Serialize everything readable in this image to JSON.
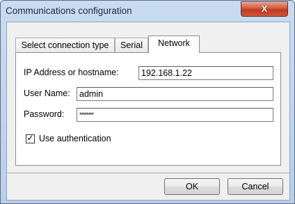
{
  "window": {
    "title": "Communications configuration",
    "close_glyph": "X"
  },
  "tabs": [
    {
      "label": "Select connection type"
    },
    {
      "label": "Serial"
    },
    {
      "label": "Network"
    }
  ],
  "form": {
    "ip_label": "IP Address or hostname:",
    "ip_value": "192.168.1.22",
    "user_label": "User Name:",
    "user_value": "admin",
    "password_label": "Password:",
    "password_value": "********",
    "auth_label": "Use authentication",
    "auth_checked": true,
    "check_glyph": "✓"
  },
  "buttons": {
    "ok": "OK",
    "cancel": "Cancel"
  }
}
